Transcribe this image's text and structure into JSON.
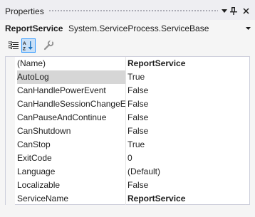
{
  "window": {
    "title": "Properties",
    "dropdown_icon": "dropdown-arrow-icon",
    "pin_icon": "pin-icon",
    "close_icon": "close-icon"
  },
  "object_selector": {
    "name": "ReportService",
    "type": "System.ServiceProcess.ServiceBase"
  },
  "toolbar": {
    "buttons": [
      {
        "icon": "categorized-icon",
        "active": false
      },
      {
        "icon": "alphabetical-icon",
        "active": true
      },
      {
        "icon": "property-pages-icon",
        "active": false
      }
    ]
  },
  "properties": [
    {
      "name": "(Name)",
      "value": "ReportService",
      "bold_value": true
    },
    {
      "name": "AutoLog",
      "value": "True",
      "selected": true
    },
    {
      "name": "CanHandlePowerEvent",
      "value": "False"
    },
    {
      "name": "CanHandleSessionChangeEv",
      "value": "False"
    },
    {
      "name": "CanPauseAndContinue",
      "value": "False"
    },
    {
      "name": "CanShutdown",
      "value": "False"
    },
    {
      "name": "CanStop",
      "value": "True"
    },
    {
      "name": "ExitCode",
      "value": "0"
    },
    {
      "name": "Language",
      "value": "(Default)"
    },
    {
      "name": "Localizable",
      "value": "False"
    },
    {
      "name": "ServiceName",
      "value": "ReportService",
      "bold_value": true
    }
  ],
  "colors": {
    "accent": "#3399ff",
    "selected_row": "#d6d6d6",
    "grid_line": "#e5e5e5"
  }
}
